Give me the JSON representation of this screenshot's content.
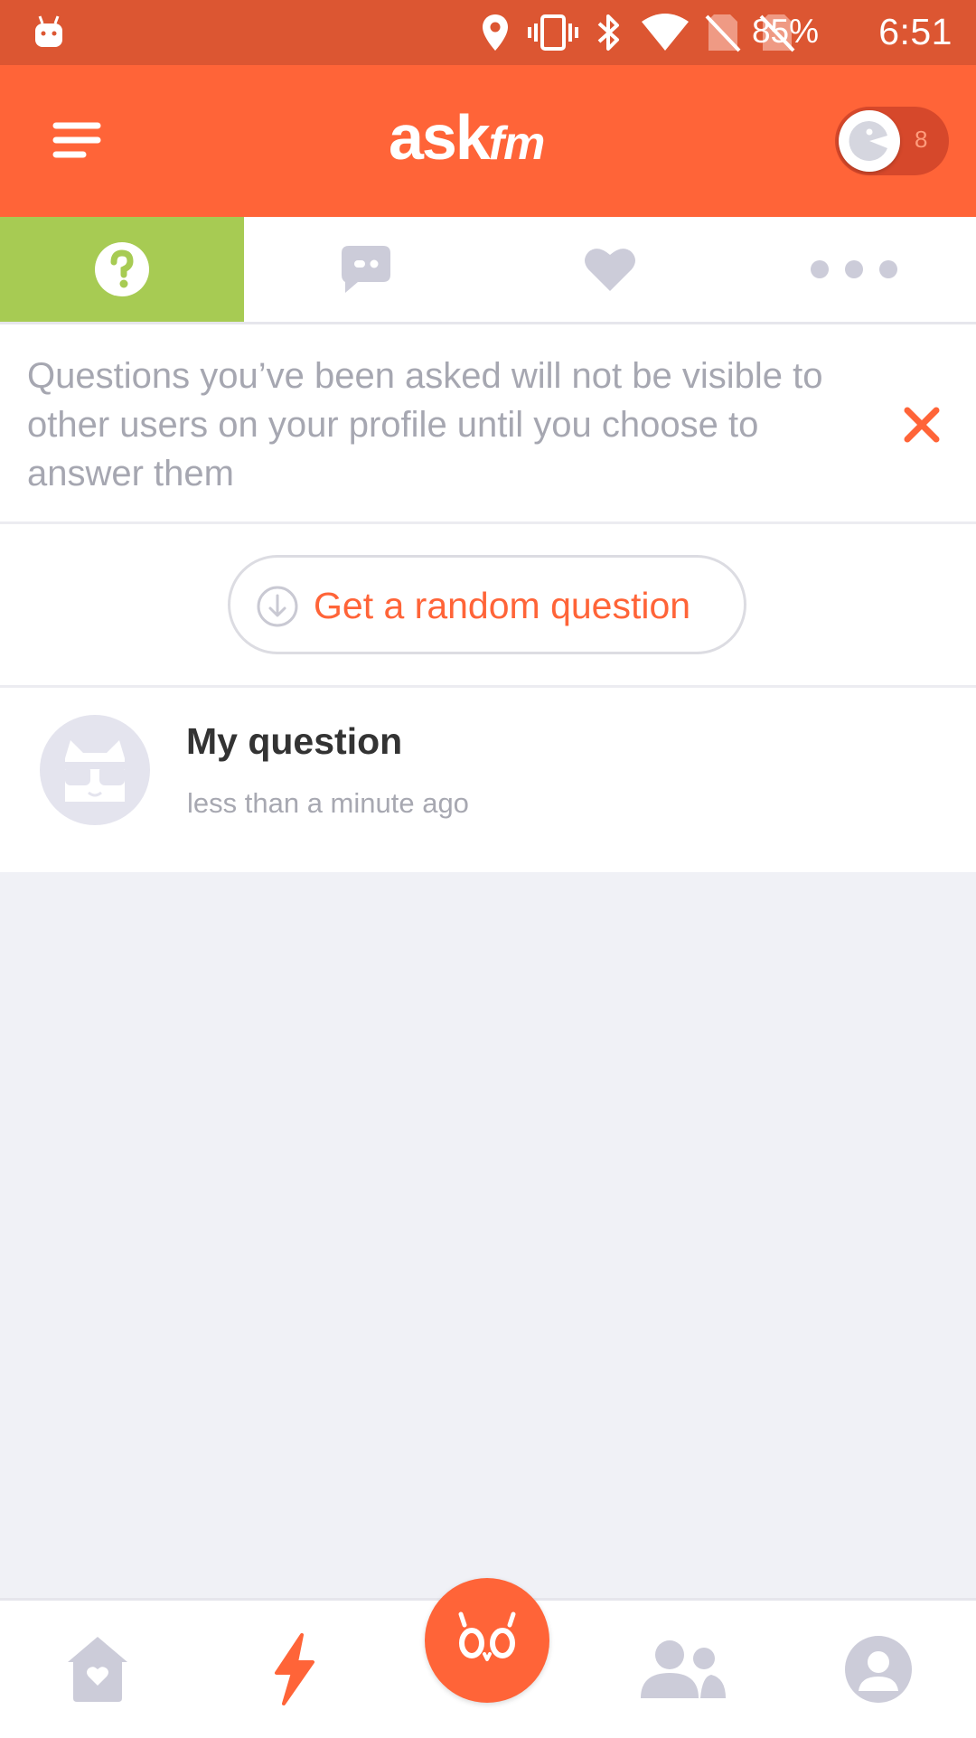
{
  "status_bar": {
    "battery": "85%",
    "time": "6:51",
    "icons": [
      "android-icon",
      "location-icon",
      "vibrate-icon",
      "bluetooth-icon",
      "wifi-icon",
      "no-sim-icon",
      "no-sim-icon"
    ]
  },
  "header": {
    "logo_ask": "ask",
    "logo_fm": "fm",
    "toggle_count": "8"
  },
  "tabs": [
    {
      "name": "questions",
      "icon": "question-icon",
      "active": true
    },
    {
      "name": "chats",
      "icon": "chat-bubble-icon",
      "active": false
    },
    {
      "name": "likes",
      "icon": "heart-icon",
      "active": false
    },
    {
      "name": "more",
      "icon": "more-dots-icon",
      "active": false
    }
  ],
  "banner": {
    "text": "Questions you’ve been asked will not be visible to other users on your profile until you choose to answer them"
  },
  "random_button": {
    "label": "Get a random question"
  },
  "questions": [
    {
      "title": "My question",
      "time": "less than a minute ago"
    }
  ],
  "bottom_nav": [
    "home-heart-icon",
    "lightning-icon",
    "owl-ask-icon",
    "friends-icon",
    "profile-icon"
  ],
  "colors": {
    "brand": "#ff6438",
    "status_bar": "#dc5632",
    "active_tab": "#a7cb53",
    "muted_icon": "#ccccd9",
    "background": "#f0f1f6"
  }
}
